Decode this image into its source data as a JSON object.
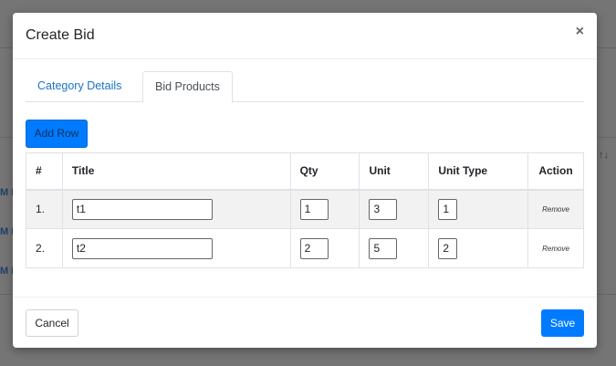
{
  "background": {
    "link_fragments": [
      "M H",
      "M H",
      "M H"
    ],
    "sort_arrows": "↑↓"
  },
  "modal": {
    "title": "Create Bid",
    "close_glyph": "×",
    "tabs": [
      {
        "label": "Category Details",
        "active": false
      },
      {
        "label": "Bid Products",
        "active": true
      }
    ],
    "add_row_label": "Add Row",
    "table": {
      "headers": [
        "#",
        "Title",
        "Qty",
        "Unit",
        "Unit Type",
        "Action"
      ],
      "rows": [
        {
          "index": "1.",
          "title": "t1",
          "qty": "1",
          "unit": "3",
          "unit_type": "1",
          "action": "Remove"
        },
        {
          "index": "2.",
          "title": "t2",
          "qty": "2",
          "unit": "5",
          "unit_type": "2",
          "action": "Remove"
        }
      ]
    },
    "footer": {
      "cancel_label": "Cancel",
      "save_label": "Save"
    }
  },
  "colors": {
    "primary": "#007bff",
    "link": "#1a73c8",
    "backdrop": "#757575"
  }
}
